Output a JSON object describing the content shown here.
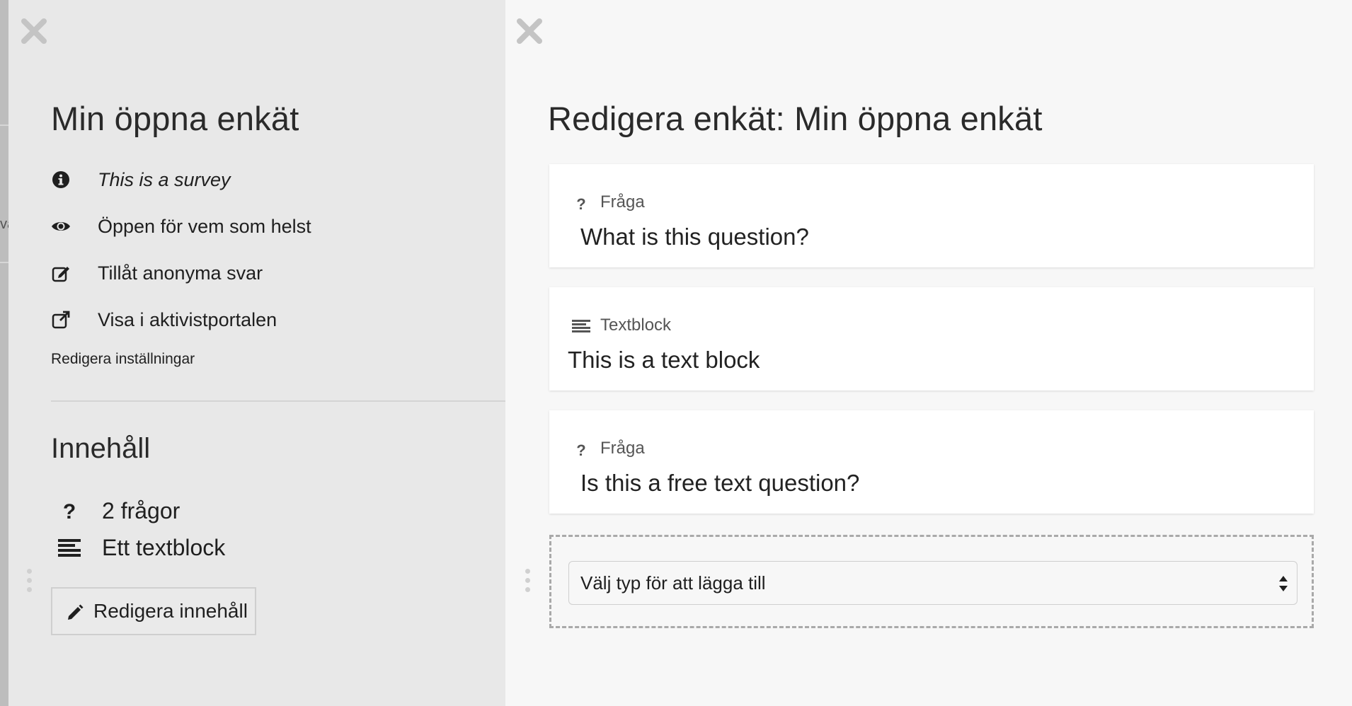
{
  "background": {
    "partial_text": "va"
  },
  "left_panel": {
    "close_label": "close",
    "title": "Min öppna enkät",
    "settings": [
      {
        "icon": "info-icon",
        "text": "This is a survey",
        "italic": true
      },
      {
        "icon": "eye-icon",
        "text": "Öppen för vem som helst"
      },
      {
        "icon": "edit-square-icon",
        "text": "Tillåt anonyma svar"
      },
      {
        "icon": "external-link-icon",
        "text": "Visa i aktivistportalen"
      }
    ],
    "edit_settings_link": "Redigera inställningar",
    "content_section": {
      "title": "Innehåll",
      "summary": [
        {
          "icon": "question-icon",
          "text": "2 frågor"
        },
        {
          "icon": "text-lines-icon",
          "text": "Ett textblock"
        }
      ],
      "edit_button": {
        "icon": "pencil-icon",
        "label": "Redigera innehåll"
      }
    }
  },
  "right_panel": {
    "title": "Redigera enkät: Min öppna enkät",
    "cards": [
      {
        "type": "question",
        "type_label": "Fråga",
        "icon": "question-icon",
        "text": "What is this question?"
      },
      {
        "type": "textblock",
        "type_label": "Textblock",
        "icon": "text-lines-icon",
        "text": "This is a text block"
      },
      {
        "type": "question",
        "type_label": "Fråga",
        "icon": "question-icon",
        "text": "Is this a free text question?"
      }
    ],
    "add_select": {
      "value": "Välj typ för att lägga till",
      "icon": "select-arrows-icon"
    }
  },
  "colors": {
    "left_panel_bg": "#e8e8e8",
    "right_panel_bg": "#f7f7f7",
    "card_bg": "#ffffff",
    "close_icon": "#c4c4c4"
  }
}
